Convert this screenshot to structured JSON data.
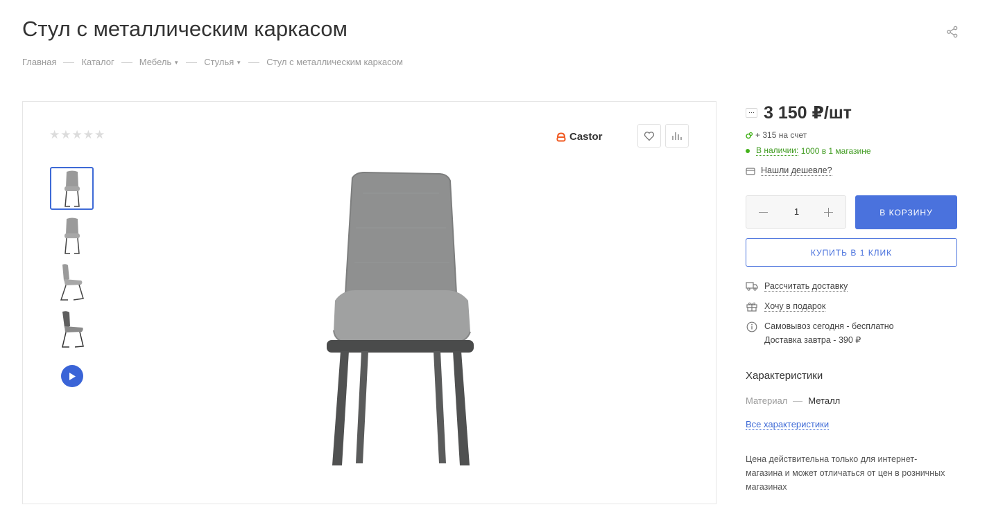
{
  "page": {
    "title": "Стул с металлическим каркасом",
    "share_icon": "share-icon"
  },
  "breadcrumbs": [
    {
      "label": "Главная",
      "dropdown": false
    },
    {
      "label": "Каталог",
      "dropdown": false
    },
    {
      "label": "Мебель",
      "dropdown": true
    },
    {
      "label": "Стулья",
      "dropdown": true
    },
    {
      "label": "Стул с металлическим каркасом",
      "dropdown": false
    }
  ],
  "gallery": {
    "rating": {
      "stars": "★★★★★",
      "value": 0,
      "max": 5
    },
    "brand": "Castor",
    "brand_color": "#f05a22",
    "favorite_icon": "heart-icon",
    "compare_icon": "compare-bars-icon",
    "thumbnails": [
      "chair-front",
      "chair-front-2",
      "chair-side",
      "chair-back"
    ],
    "active_thumbnail": 0,
    "video_icon": "play-icon"
  },
  "buy": {
    "price": "3 150 ₽/шт",
    "bonus": "+ 315 на счет",
    "stock_label": "В наличии:",
    "stock_value": "1000 в 1 магазине",
    "cheaper_label": "Нашли дешевле?",
    "quantity": "1",
    "cart_label": "В КОРЗИНУ",
    "one_click_label": "КУПИТЬ В 1 КЛИК",
    "accent_color": "#4a72dd",
    "stock_color": "#3d9a1d"
  },
  "options": {
    "delivery_calc": "Рассчитать доставку",
    "gift": "Хочу в подарок",
    "pickup_line1": "Самовывоз сегодня - бесплатно",
    "pickup_line2": "Доставка завтра - 390 ₽"
  },
  "characteristics": {
    "title": "Характеристики",
    "rows": [
      {
        "key": "Материал",
        "value": "Металл"
      }
    ],
    "all_link": "Все характеристики"
  },
  "note": "Цена действительна только для интернет-магазина и может отличаться от цен в розничных магазинах"
}
